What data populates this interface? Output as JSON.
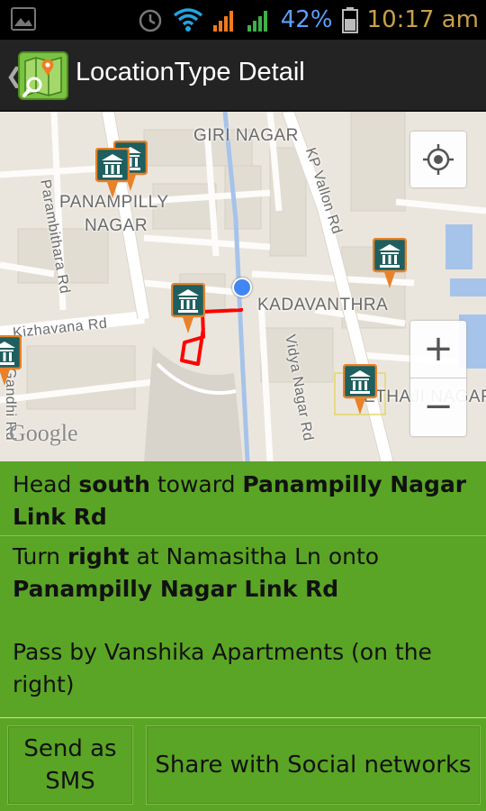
{
  "status_bar": {
    "battery_percent": "42%",
    "time": "10:17 am"
  },
  "action_bar": {
    "title": "LocationType Detail"
  },
  "map": {
    "labels": {
      "giri_nagar": "GIRI NAGAR",
      "panampilly_1": "PANAMPILLY",
      "panampilly_2": "NAGAR",
      "kadavanthra": "KADAVANTHRA",
      "kizhavana_rd": "Kizhavana Rd",
      "parambithara_rd": "Parambithara Rd",
      "kp_vallon_rd": "KP Vallon Rd",
      "vidya_nagar_rd": "Vidya Nagar Rd",
      "gandhi_rd": "Gandhi Rd",
      "nethaji_nagar": "ETHAJI NAGAR"
    },
    "zoom_in": "+",
    "zoom_out": "−",
    "attribution": "Google",
    "route_color": "#ff0000",
    "marker_color": "#1f5f5f",
    "accent_color": "#e8822a"
  },
  "directions": {
    "steps": [
      {
        "pre": "Head ",
        "b1": "south",
        "mid": " toward ",
        "b2": "Panampilly Nagar Link Rd"
      },
      {
        "pre": "Turn ",
        "b1": "right",
        "mid": " at Namasitha Ln onto ",
        "b2": "Panampilly Nagar Link Rd"
      },
      {
        "text": "Pass by Vanshika Apartments (on the right)"
      }
    ]
  },
  "buttons": {
    "send_sms": "Send as SMS",
    "share_social": "Share with Social networks"
  },
  "colors": {
    "panel_green": "#5aa525",
    "action_bar": "#232323"
  }
}
